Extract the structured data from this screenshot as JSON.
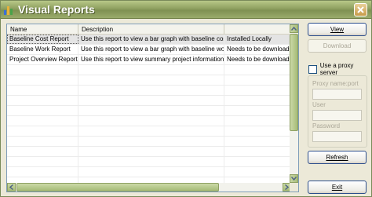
{
  "window": {
    "title": "Visual Reports",
    "accent": "#8fa061"
  },
  "table": {
    "columns": [
      "Name",
      "Description",
      ""
    ],
    "rows": [
      {
        "name": "Baseline Cost Report",
        "description": "Use this report to view a bar graph with baseline cost, pl",
        "status": "Installed Locally"
      },
      {
        "name": "Baseline Work Report",
        "description": "Use this report to view a bar graph with baseline work, p",
        "status": "Needs to be downloaded"
      },
      {
        "name": "Project Overview Report",
        "description": "Use this report to view summary project information at a",
        "status": "Needs to be downloaded"
      }
    ]
  },
  "buttons": {
    "view": "View",
    "download": "Download",
    "refresh": "Refresh",
    "exit": "Exit"
  },
  "proxy": {
    "checkbox_label": "Use a proxy server",
    "name_port_label": "Proxy name:port",
    "user_label": "User",
    "password_label": "Password"
  }
}
